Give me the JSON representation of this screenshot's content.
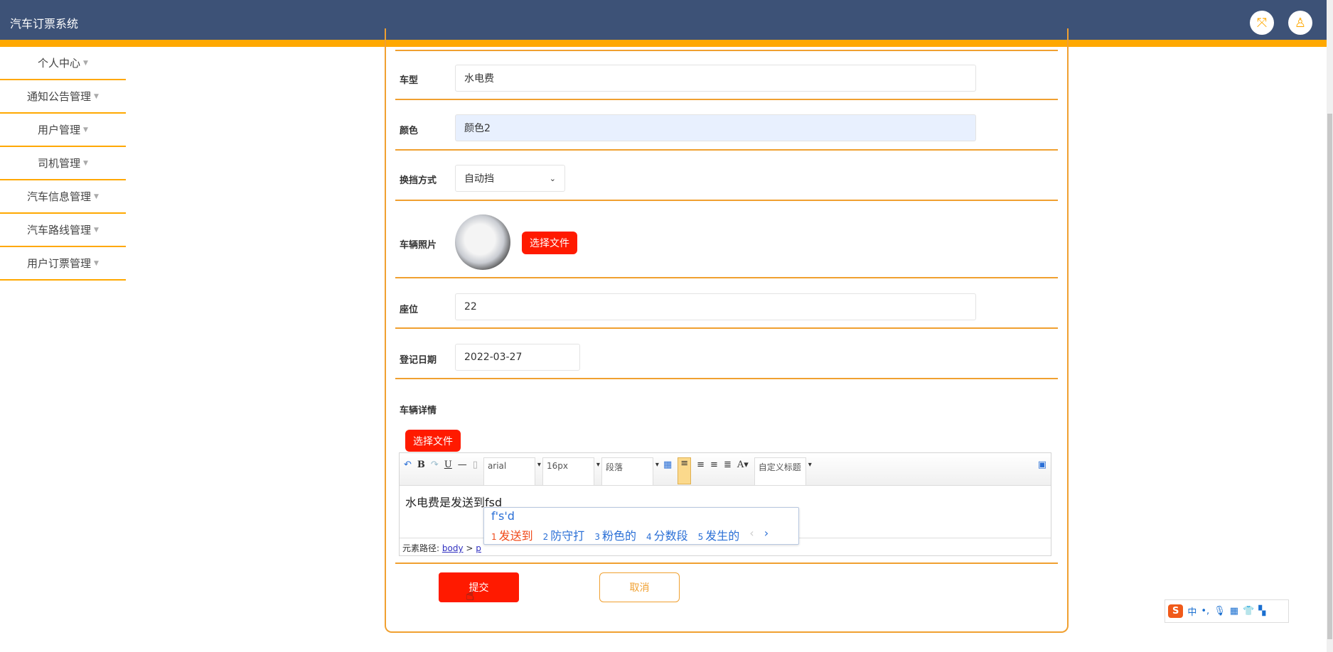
{
  "header": {
    "title": "汽车订票系统",
    "icons": [
      "fullscreen-icon",
      "user-icon"
    ]
  },
  "sidebar": {
    "items": [
      {
        "label": "个人中心"
      },
      {
        "label": "通知公告管理"
      },
      {
        "label": "用户管理"
      },
      {
        "label": "司机管理"
      },
      {
        "label": "汽车信息管理"
      },
      {
        "label": "汽车路线管理"
      },
      {
        "label": "用户订票管理"
      }
    ]
  },
  "form": {
    "car_type": {
      "label": "车型",
      "value": "水电费"
    },
    "color": {
      "label": "颜色",
      "value": "颜色2"
    },
    "gear": {
      "label": "换挡方式",
      "value": "自动挡"
    },
    "photo": {
      "label": "车辆照片",
      "button": "选择文件"
    },
    "seats": {
      "label": "座位",
      "value": "22"
    },
    "reg_date": {
      "label": "登记日期",
      "value": "2022-03-27"
    },
    "details": {
      "label": "车辆详情",
      "button": "选择文件",
      "toolbar": {
        "font": "arial",
        "size": "16px",
        "paragraph": "段落",
        "heading": "自定义标题",
        "bold": "B",
        "underline": "U",
        "fontcolor": "A"
      },
      "content": "水电费是发送到fsd",
      "path_label": "元素路径:",
      "path_body": "body",
      "path_sep": ">",
      "path_p": "p"
    },
    "submit": "提交",
    "cancel": "取消"
  },
  "ime": {
    "composition": "f's'd",
    "candidates": [
      {
        "n": "1",
        "t": "发送到"
      },
      {
        "n": "2",
        "t": "防守打"
      },
      {
        "n": "3",
        "t": "粉色的"
      },
      {
        "n": "4",
        "t": "分数段"
      },
      {
        "n": "5",
        "t": "发生的"
      }
    ],
    "sogou_mode": "中"
  },
  "colors": {
    "header": "#3d5277",
    "accent": "#ffa800",
    "button": "#ff1a00"
  }
}
